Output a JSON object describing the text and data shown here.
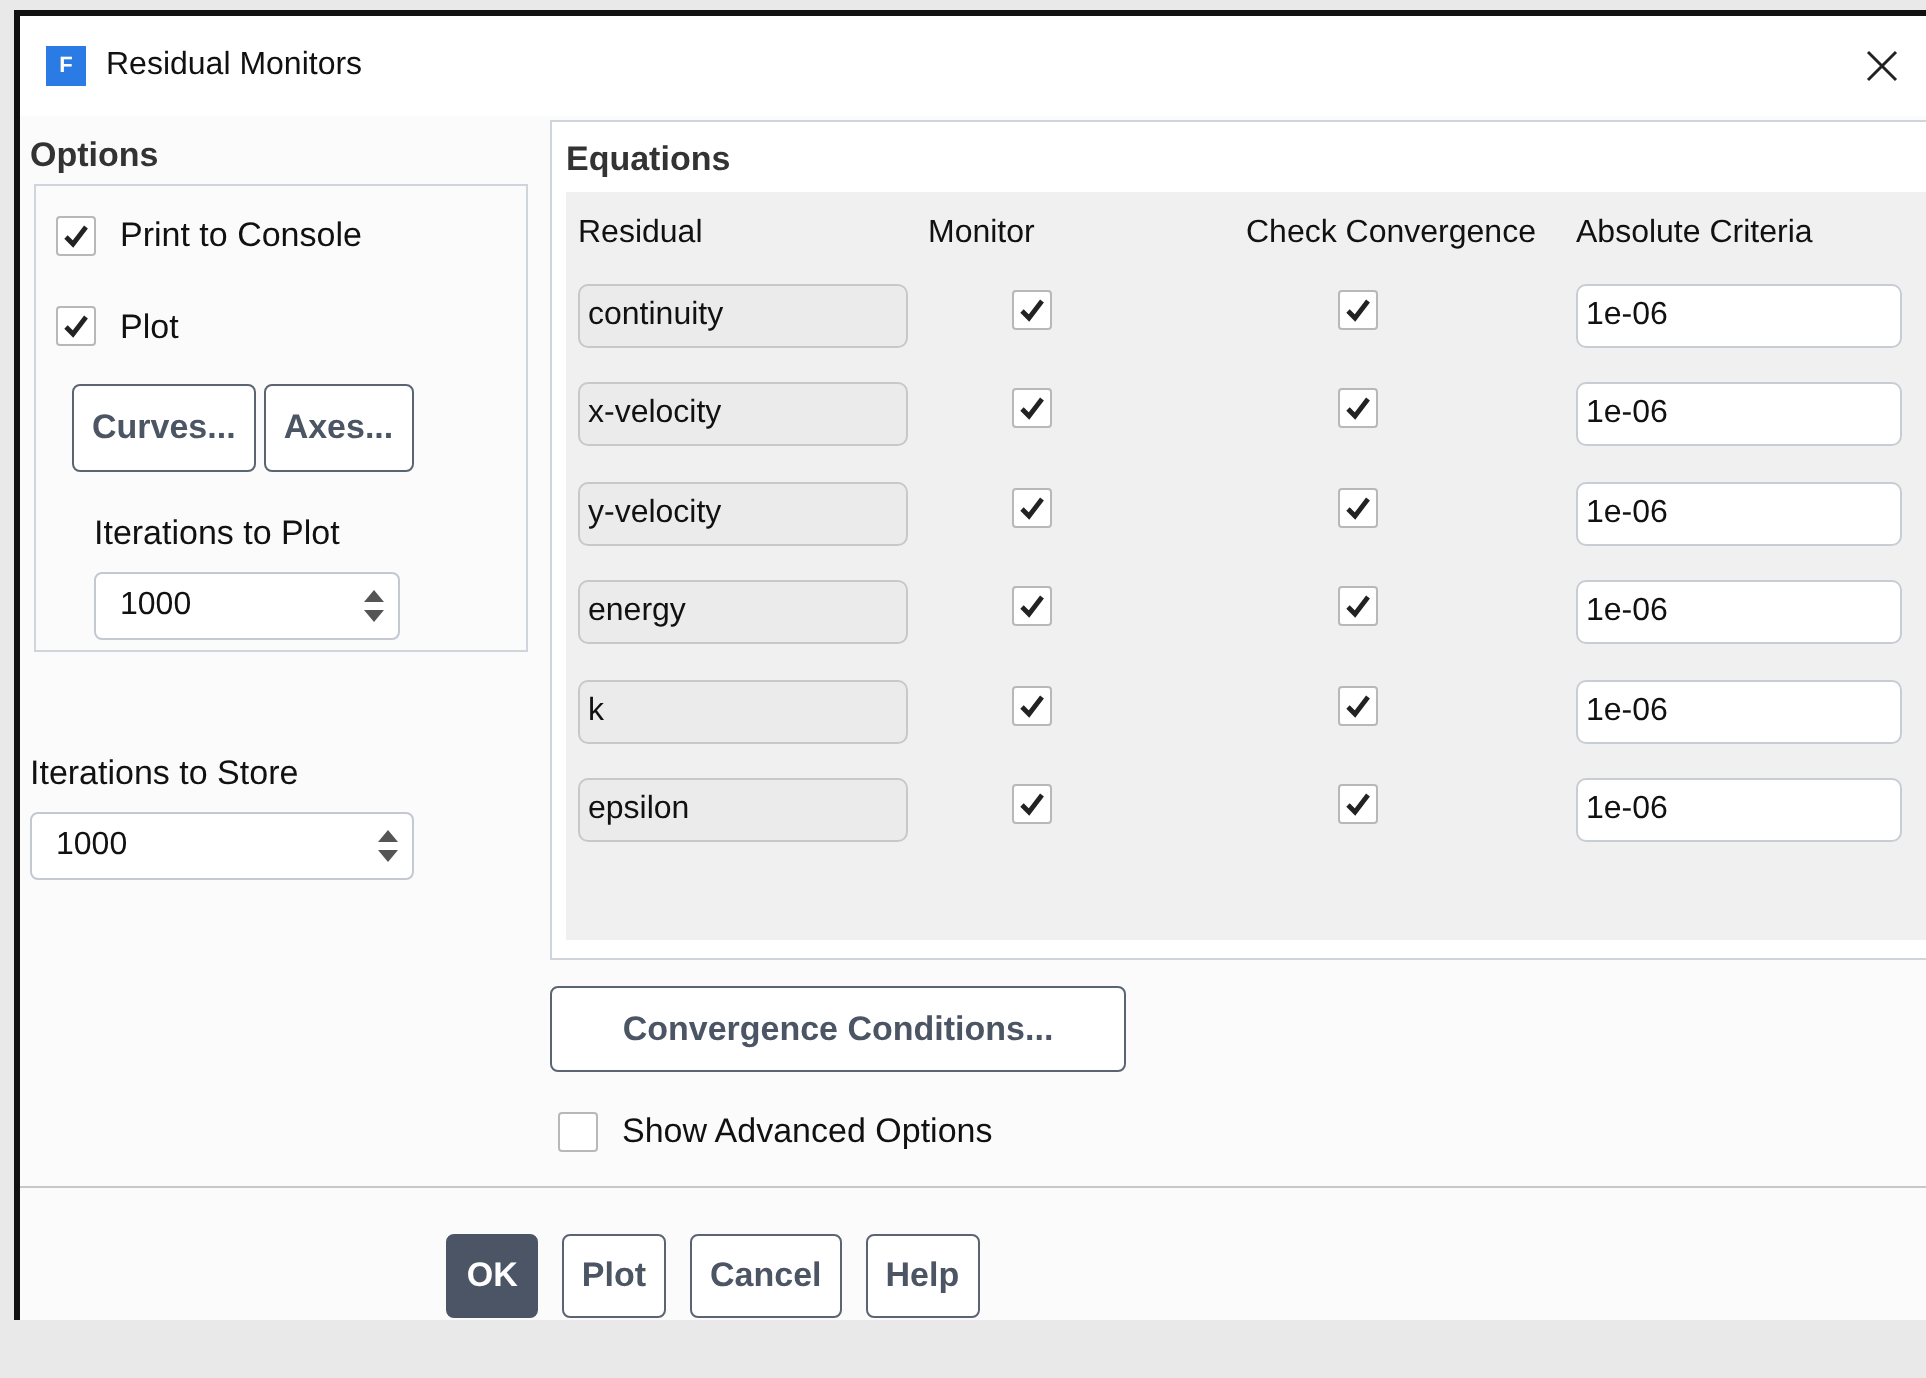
{
  "window": {
    "title": "Residual Monitors",
    "app_icon_letter": "F"
  },
  "options": {
    "heading": "Options",
    "print_to_console": {
      "label": "Print to Console",
      "checked": true
    },
    "plot": {
      "label": "Plot",
      "checked": true
    },
    "buttons": [
      "Curves...",
      "Axes..."
    ],
    "iterations_to_plot": {
      "label": "Iterations to Plot",
      "value": "1000"
    }
  },
  "iterations_to_store": {
    "label": "Iterations to Store",
    "value": "1000"
  },
  "equations": {
    "heading": "Equations",
    "columns": [
      "Residual",
      "Monitor",
      "Check Convergence",
      "Absolute Criteria"
    ],
    "rows": [
      {
        "residual": "continuity",
        "monitor": true,
        "check_convergence": true,
        "absolute_criteria": "1e-06"
      },
      {
        "residual": "x-velocity",
        "monitor": true,
        "check_convergence": true,
        "absolute_criteria": "1e-06"
      },
      {
        "residual": "y-velocity",
        "monitor": true,
        "check_convergence": true,
        "absolute_criteria": "1e-06"
      },
      {
        "residual": "energy",
        "monitor": true,
        "check_convergence": true,
        "absolute_criteria": "1e-06"
      },
      {
        "residual": "k",
        "monitor": true,
        "check_convergence": true,
        "absolute_criteria": "1e-06"
      },
      {
        "residual": "epsilon",
        "monitor": true,
        "check_convergence": true,
        "absolute_criteria": "1e-06"
      }
    ]
  },
  "convergence_conditions_button": "Convergence Conditions...",
  "show_advanced_options": {
    "label": "Show Advanced Options",
    "checked": false
  },
  "footer_buttons": [
    {
      "label": "OK",
      "default": true
    },
    {
      "label": "Plot",
      "default": false
    },
    {
      "label": "Cancel",
      "default": false
    },
    {
      "label": "Help",
      "default": false
    }
  ]
}
